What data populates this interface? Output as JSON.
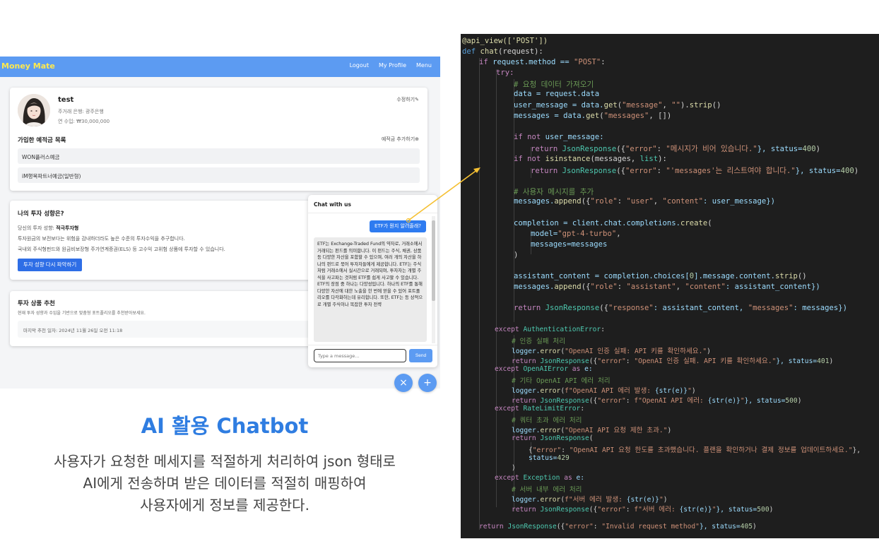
{
  "app": {
    "brand": "Money Mate",
    "nav": {
      "logout": "Logout",
      "profile": "My Profile",
      "menu": "Menu"
    },
    "profile": {
      "name": "test",
      "bank": "주거래 은행: 광주은행",
      "income": "연 수입: ₩30,000,000",
      "edit_label": "수정하기✎",
      "deposits_title": "가입한 예적금 목록",
      "add_label": "예적금 추가하기⊕",
      "deposits": [
        "WON플러스예금",
        "iM행복파트너예금(일반형)"
      ]
    },
    "investment": {
      "title": "나의 투자 성향은?",
      "type_prefix": "당신의 투자 성향: ",
      "type_value": "적극투자형",
      "desc1": "투자원금의 보전보다는 위험을 감내하더라도 높은 수준의 투자수익을 추구합니다.",
      "desc2": "국내외 주식형펀드와 원금비보장형 주가연계증권(ELS) 등 고수익 고위험 상품에 투자할 수 있습니다.",
      "retake_label": "투자 성향 다시 파악하기"
    },
    "recommend": {
      "title": "투자 상품 추천",
      "subtitle": "현재 투자 성향과 수입을 기반으로 맞춤형 포트폴리오를 추천받아보세요.",
      "last": "마지막 추천 일자: 2024년 11월 26일 오전 11:18"
    },
    "chat": {
      "title": "Chat with us",
      "user_message": "ETF가 뭔지 알려줄래?",
      "bot_message": "ETF는 Exchange-Traded Fund의 약자로, 거래소에서 거래되는 펀드를 의미합니다. 이 펀드는 주식, 채권, 상품 등 다양한 자산을 포함할 수 있으며, 여러 개의 자산을 하나의 펀드로 묶어 투자자들에게 제공합니다. ETF는 주식처럼 거래소에서 실시간으로 거래되며, 투자자는 개별 주식을 사고파는 것처럼 ETF를 쉽게 사고팔 수 있습니다. ETF의 장점 중 하나는 다양성입니다. 하나의 ETF를 통해 다양한 자산에 대한 노출을 한 번에 얻을 수 있어 포트폴리오를 다각화하는데 유리합니다. 또한, ETF는 등 상적으로 개별 주식이나 복잡한 투자 전략",
      "placeholder": "Type a message...",
      "send_label": "Send",
      "close_icon": "×",
      "plus_icon": "+"
    }
  },
  "caption": {
    "title": "AI 활용 Chatbot",
    "body": "사용자가 요청한 메세지를 적절하게 처리하여 json 형태로\nAI에게 전송하며 받은 데이터를 적절히 매핑하여\n사용자에게 정보를 제공한다."
  },
  "code": {
    "l1": "@api_view(['POST'])",
    "l2a": "def ",
    "l2b": "chat",
    "l2c": "(request):",
    "l3a": "if ",
    "l3b": "request.method == ",
    "l3c": "\"POST\"",
    "l3d": ":",
    "l4": "try:",
    "l5": "# 요청 데이터 가져오기",
    "l6a": "data = request.data",
    "l7a": "user_message = data.",
    "l7b": "get",
    "l7c": "(",
    "l7d": "\"message\"",
    "l7e": ", ",
    "l7f": "\"\"",
    "l7g": ").",
    "l7h": "strip",
    "l7i": "()",
    "l8a": "messages = data.",
    "l8b": "get",
    "l8c": "(",
    "l8d": "\"messages\"",
    "l8e": ", [])",
    "l9a": "if not ",
    "l9b": "user_message:",
    "l10a": "return ",
    "l10b": "JsonResponse",
    "l10c": "({",
    "l10d": "\"error\"",
    "l10e": ": ",
    "l10f": "\"메시지가 비어 있습니다.\"",
    "l10g": "}, status=",
    "l10h": "400",
    "l10i": ")",
    "l11a": "if not ",
    "l11b": "isinstance",
    "l11c": "(messages, ",
    "l11d": "list",
    "l11e": "):",
    "l12a": "return ",
    "l12b": "JsonResponse",
    "l12c": "({",
    "l12d": "\"error\"",
    "l12e": ": ",
    "l12f": "\"'messages'는 리스트여야 합니다.\"",
    "l12g": "}, status=",
    "l12h": "400",
    "l12i": ")",
    "l13": "# 사용자 메시지를 추가",
    "l14a": "messages.",
    "l14b": "append",
    "l14c": "({",
    "l14d": "\"role\"",
    "l14e": ": ",
    "l14f": "\"user\"",
    "l14g": ", ",
    "l14h": "\"content\"",
    "l14i": ": user_message})",
    "l15a": "completion = client.chat.completions.",
    "l15b": "create",
    "l15c": "(",
    "l16a": "model=",
    "l16b": "\"gpt-4-turbo\"",
    "l16c": ",",
    "l17": "messages=messages",
    "l18": ")",
    "l19a": "assistant_content = completion.choices[",
    "l19b": "0",
    "l19c": "].message.content.",
    "l19d": "strip",
    "l19e": "()",
    "l20a": "messages.",
    "l20b": "append",
    "l20c": "({",
    "l20d": "\"role\"",
    "l20e": ": ",
    "l20f": "\"assistant\"",
    "l20g": ", ",
    "l20h": "\"content\"",
    "l20i": ": assistant_content})",
    "l21a": "return ",
    "l21b": "JsonResponse",
    "l21c": "({",
    "l21d": "\"response\"",
    "l21e": ": assistant_content, ",
    "l21f": "\"messages\"",
    "l21g": ": messages})",
    "l22a": "except ",
    "l22b": "AuthenticationError",
    "l22c": ":",
    "l23": "# 인증 실패 처리",
    "l24a": "logger.",
    "l24b": "error",
    "l24c": "(",
    "l24d": "\"OpenAI 인증 실패: API 키를 확인하세요.\"",
    "l24e": ")",
    "l25a": "return ",
    "l25b": "JsonResponse",
    "l25c": "({",
    "l25d": "\"error\"",
    "l25e": ": ",
    "l25f": "\"OpenAI 인증 실패. API 키를 확인하세요.\"",
    "l25g": "}, status=",
    "l25h": "401",
    "l25i": ")",
    "l26a": "except ",
    "l26b": "OpenAIError ",
    "l26c": "as ",
    "l26d": "e:",
    "l27": "# 기타 OpenAI API 에러 처리",
    "l28a": "logger.",
    "l28b": "error",
    "l28c": "(",
    "l28d": "f\"OpenAI API 에러 발생: ",
    "l28e": "{str(e)}",
    "l28f": "\"",
    "l28g": ")",
    "l29a": "return ",
    "l29b": "JsonResponse",
    "l29c": "({",
    "l29d": "\"error\"",
    "l29e": ": ",
    "l29f": "f\"OpenAI API 에러: ",
    "l29g": "{str(e)}",
    "l29h": "\"",
    "l29i": "}, status=",
    "l29j": "500",
    "l29k": ")",
    "l30a": "except ",
    "l30b": "RateLimitError",
    "l30c": ":",
    "l31": "# 쿼터 초과 에러 처리",
    "l32a": "logger.",
    "l32b": "error",
    "l32c": "(",
    "l32d": "\"OpenAI API 요청 제한 초과.\"",
    "l32e": ")",
    "l33a": "return ",
    "l33b": "JsonResponse",
    "l33c": "(",
    "l34a": "{",
    "l34b": "\"error\"",
    "l34c": ": ",
    "l34d": "\"OpenAI API 요청 한도를 초과했습니다. 플랜을 확인하거나 결제 정보를 업데이트하세요.\"",
    "l34e": "},",
    "l35a": "status=",
    "l35b": "429",
    "l36": ")",
    "l37a": "except ",
    "l37b": "Exception ",
    "l37c": "as ",
    "l37d": "e:",
    "l38": "# 서버 내부 에러 처리",
    "l39a": "logger.",
    "l39b": "error",
    "l39c": "(",
    "l39d": "f\"서버 에러 발생: ",
    "l39e": "{str(e)}",
    "l39f": "\"",
    "l39g": ")",
    "l40a": "return ",
    "l40b": "JsonResponse",
    "l40c": "({",
    "l40d": "\"error\"",
    "l40e": ": ",
    "l40f": "f\"서버 에러: ",
    "l40g": "{str(e)}",
    "l40h": "\"",
    "l40i": "}, status=",
    "l40j": "500",
    "l40k": ")",
    "l41a": "return ",
    "l41b": "JsonResponse",
    "l41c": "({",
    "l41d": "\"error\"",
    "l41e": ": ",
    "l41f": "\"Invalid request method\"",
    "l41g": "}, status=",
    "l41h": "405",
    "l41i": ")"
  },
  "colors": {
    "navbar": "#5c9bf2",
    "brand": "#ffe94d",
    "caption_title": "#2f7de1",
    "code_bg": "#1e1e1e",
    "arrow": "#f5c033"
  }
}
